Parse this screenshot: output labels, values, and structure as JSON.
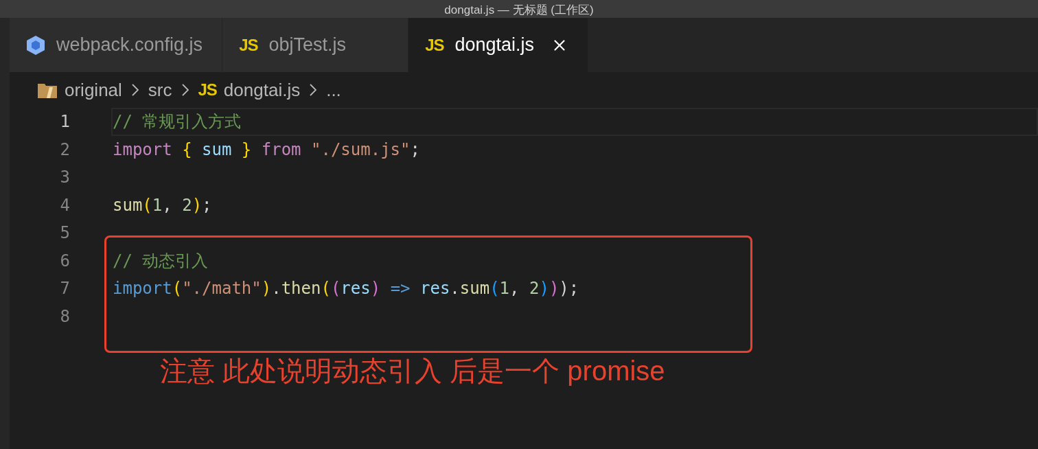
{
  "window": {
    "title": "dongtai.js — 无标题 (工作区)"
  },
  "tabs": [
    {
      "label": "webpack.config.js",
      "kind": "webpack",
      "selected": false
    },
    {
      "label": "objTest.js",
      "kind": "js",
      "icon_label": "JS",
      "selected": false
    },
    {
      "label": "dongtai.js",
      "kind": "js",
      "icon_label": "JS",
      "selected": true
    }
  ],
  "breadcrumbs": [
    {
      "label": "original",
      "kind": "folder"
    },
    {
      "label": "src"
    },
    {
      "label": "dongtai.js",
      "kind": "js",
      "icon_label": "JS"
    },
    {
      "label": "..."
    }
  ],
  "editor": {
    "lines": [
      {
        "number": "1",
        "current": true,
        "tokens": [
          {
            "text": "// 常规引入方式",
            "kind": "comment"
          }
        ]
      },
      {
        "number": "2",
        "current": false,
        "tokens": [
          {
            "text": "import ",
            "kind": "keyword"
          },
          {
            "text": "{ ",
            "kind": "bracket1"
          },
          {
            "text": "sum ",
            "kind": "variable"
          },
          {
            "text": "} ",
            "kind": "bracket1"
          },
          {
            "text": "from ",
            "kind": "keyword"
          },
          {
            "text": "\"./sum.js\"",
            "kind": "string"
          },
          {
            "text": ";",
            "kind": "plain"
          }
        ]
      },
      {
        "number": "3",
        "current": false
      },
      {
        "number": "4",
        "current": false,
        "tokens": [
          {
            "text": "sum",
            "kind": "function"
          },
          {
            "text": "(",
            "kind": "bracket1"
          },
          {
            "text": "1",
            "kind": "number"
          },
          {
            "text": ", ",
            "kind": "plain"
          },
          {
            "text": "2",
            "kind": "number"
          },
          {
            "text": ")",
            "kind": "bracket1"
          },
          {
            "text": ";",
            "kind": "plain"
          }
        ]
      },
      {
        "number": "5",
        "current": false
      },
      {
        "number": "6",
        "current": false,
        "tokens": [
          {
            "text": "// 动态引入",
            "kind": "comment"
          }
        ]
      },
      {
        "number": "7",
        "current": false,
        "tokens": [
          {
            "text": "import",
            "kind": "storage"
          },
          {
            "text": "(",
            "kind": "bracket1"
          },
          {
            "text": "\"./math\"",
            "kind": "string"
          },
          {
            "text": ")",
            "kind": "bracket1"
          },
          {
            "text": ".",
            "kind": "plain"
          },
          {
            "text": "then",
            "kind": "function"
          },
          {
            "text": "(",
            "kind": "bracket1"
          },
          {
            "text": "(",
            "kind": "bracket2"
          },
          {
            "text": "res",
            "kind": "variable"
          },
          {
            "text": ") ",
            "kind": "bracket2"
          },
          {
            "text": "=> ",
            "kind": "storage"
          },
          {
            "text": "res",
            "kind": "variable"
          },
          {
            "text": ".",
            "kind": "plain"
          },
          {
            "text": "sum",
            "kind": "function"
          },
          {
            "text": "(",
            "kind": "bracket3"
          },
          {
            "text": "1",
            "kind": "number"
          },
          {
            "text": ", ",
            "kind": "plain"
          },
          {
            "text": "2",
            "kind": "number"
          },
          {
            "text": ")",
            "kind": "bracket3"
          },
          {
            "text": ")",
            "kind": "bracket2"
          },
          {
            "text": ");",
            "kind": "plain"
          }
        ]
      },
      {
        "number": "8",
        "current": false
      }
    ]
  },
  "annotation": {
    "note": "注意 此处说明动态引入 后是一个 promise"
  }
}
